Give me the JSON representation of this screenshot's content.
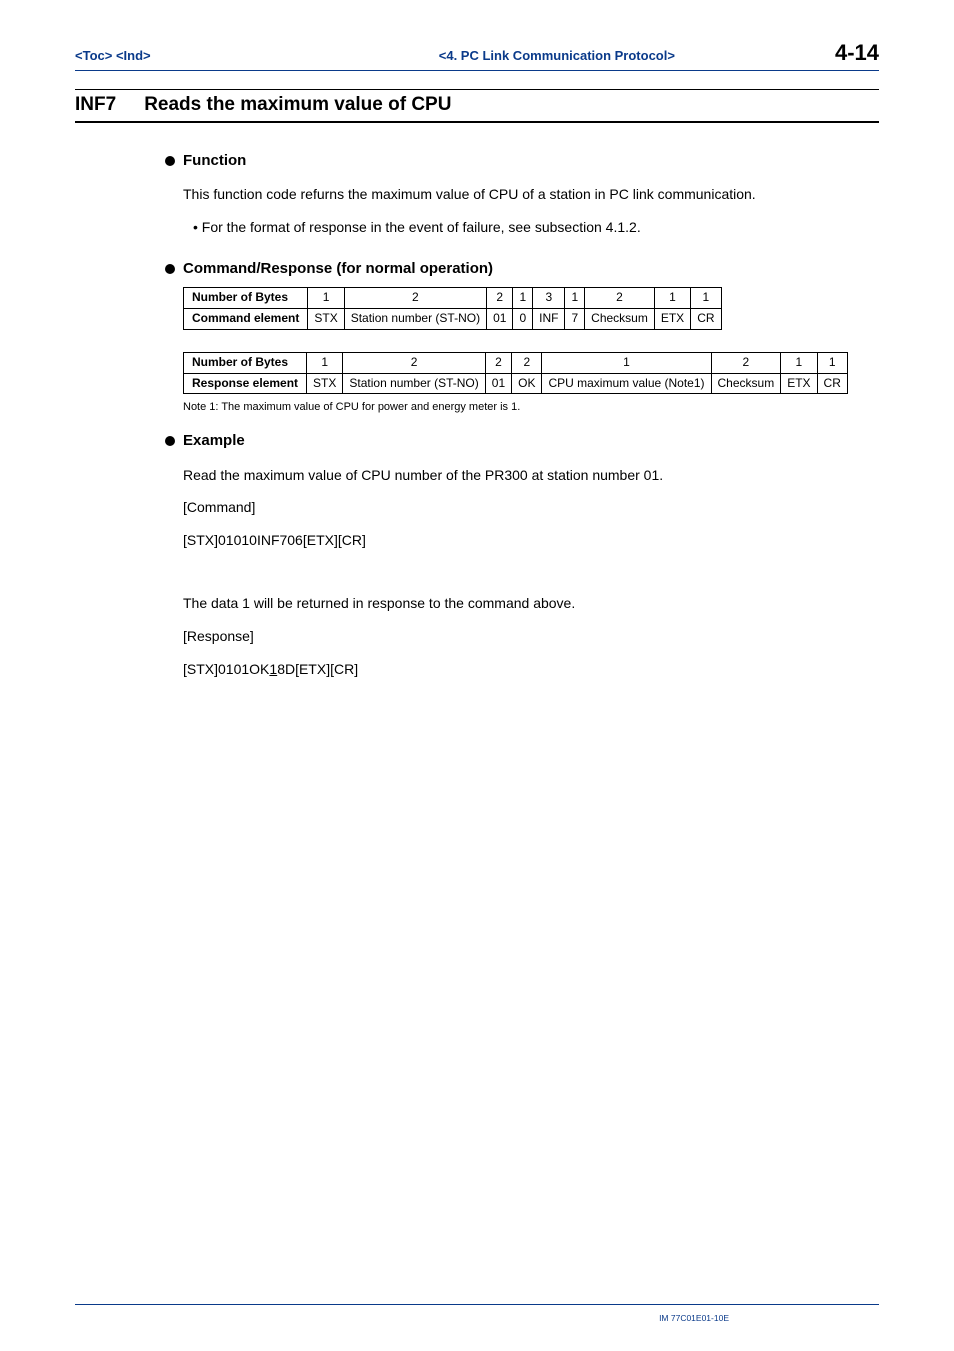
{
  "header": {
    "nav_toc": "<Toc>",
    "nav_ind": "<Ind>",
    "chapter": "<4.  PC Link Communication Protocol>",
    "page_no": "4-14"
  },
  "section": {
    "code": "INF7",
    "title": "Reads the maximum value of CPU"
  },
  "function": {
    "heading": "Function",
    "para": "This function code refurns the maximum value of CPU of a station in PC link communication.",
    "bullet": "•  For the format of response in the event of failure, see subsection 4.1.2."
  },
  "cmdresp": {
    "heading": "Command/Response (for normal operation)"
  },
  "table_cmd": {
    "row1_label": "Number of Bytes",
    "row1": [
      "1",
      "2",
      "2",
      "1",
      "3",
      "1",
      "2",
      "1",
      "1"
    ],
    "row2_label": "Command element",
    "row2": [
      "STX",
      "Station number (ST-NO)",
      "01",
      "0",
      "INF",
      "7",
      "Checksum",
      "ETX",
      "CR"
    ]
  },
  "table_resp": {
    "row1_label": "Number of Bytes",
    "row1": [
      "1",
      "2",
      "2",
      "2",
      "1",
      "2",
      "1",
      "1"
    ],
    "row2_label": "Response element",
    "row2": [
      "STX",
      "Station number (ST-NO)",
      "01",
      "OK",
      "CPU maximum value (Note1)",
      "Checksum",
      "ETX",
      "CR"
    ]
  },
  "note1": "Note 1:    The maximum value of CPU for power and energy meter is 1.",
  "example": {
    "heading": "Example",
    "line1": "Read the maximum value of CPU number of the PR300 at station number 01.",
    "cmd_label": "[Command]",
    "cmd_text": "[STX]01010INF706[ETX][CR]",
    "resp_intro": "The data 1 will be returned in response to the command above.",
    "resp_label": "[Response]",
    "resp_pre": "[STX]0101OK",
    "resp_u": "1",
    "resp_post": "8D[ETX][CR]"
  },
  "footer": {
    "docid": "IM 77C01E01-10E"
  }
}
